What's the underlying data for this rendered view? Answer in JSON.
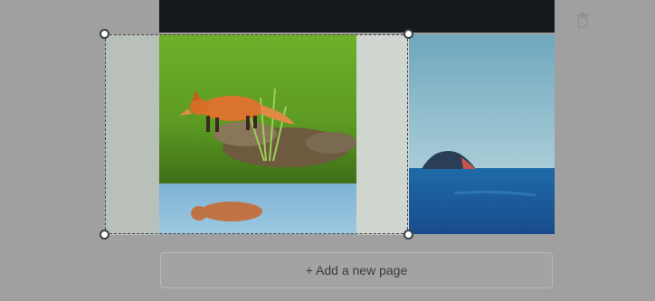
{
  "editor": {
    "add_page_label": "+ Add a new page"
  },
  "icons": {
    "delete": "trash-icon"
  },
  "colors": {
    "backdrop": "#a0a0a0",
    "page_header": "#15191d",
    "handle_fill": "#ffffff",
    "handle_border": "#3b4046"
  }
}
